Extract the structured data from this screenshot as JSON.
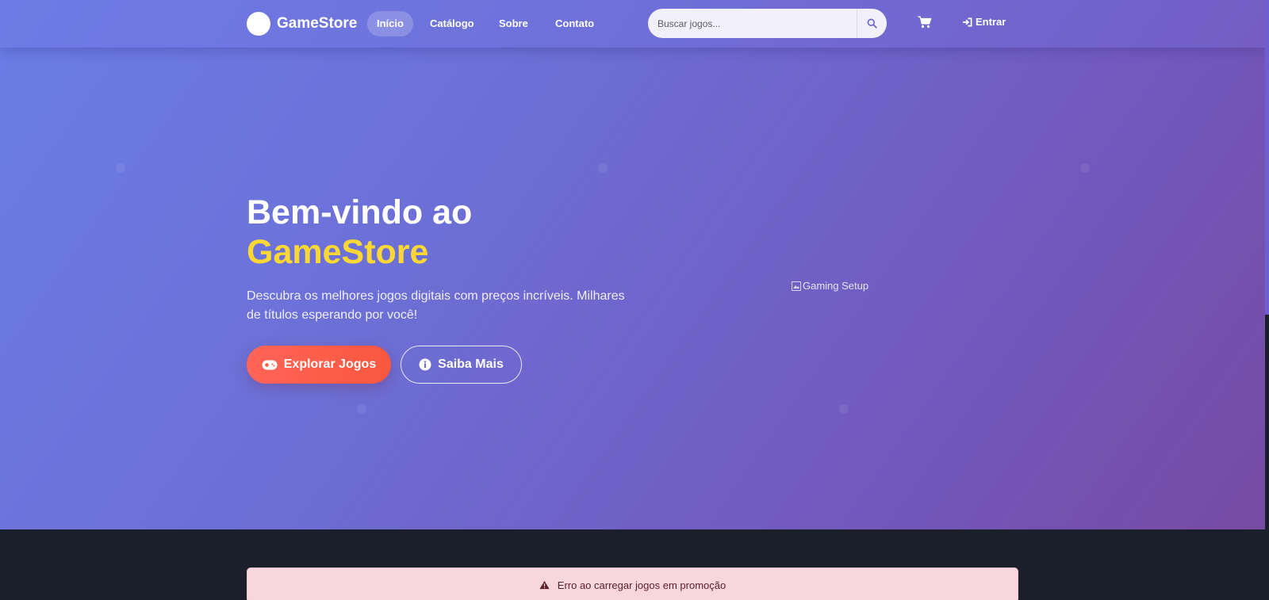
{
  "navbar": {
    "brand": "GameStore",
    "links": [
      {
        "label": "Início",
        "active": true
      },
      {
        "label": "Catálogo",
        "active": false
      },
      {
        "label": "Sobre",
        "active": false
      },
      {
        "label": "Contato",
        "active": false
      }
    ],
    "search_placeholder": "Buscar jogos...",
    "login_label": "Entrar"
  },
  "hero": {
    "title_line1": "Bem-vindo ao",
    "title_line2": "GameStore",
    "subtitle": "Descubra os melhores jogos digitais com preços incríveis. Milhares de títulos esperando por você!",
    "primary_button": "Explorar Jogos",
    "secondary_button": "Saiba Mais",
    "image_alt": "Gaming Setup"
  },
  "alert": {
    "message": "Erro ao carregar jogos em promoção"
  },
  "colors": {
    "accent_yellow": "#fdd835",
    "primary_button": "#ff6458",
    "alert_bg": "#f7d7db",
    "dark_section": "#1b1e2b"
  },
  "icons": {
    "search": "search-icon",
    "cart": "cart-icon",
    "login": "sign-in-icon",
    "gamepad": "gamepad-icon",
    "info": "info-circle-icon",
    "warning": "warning-triangle-icon",
    "broken_image": "broken-image-icon"
  }
}
